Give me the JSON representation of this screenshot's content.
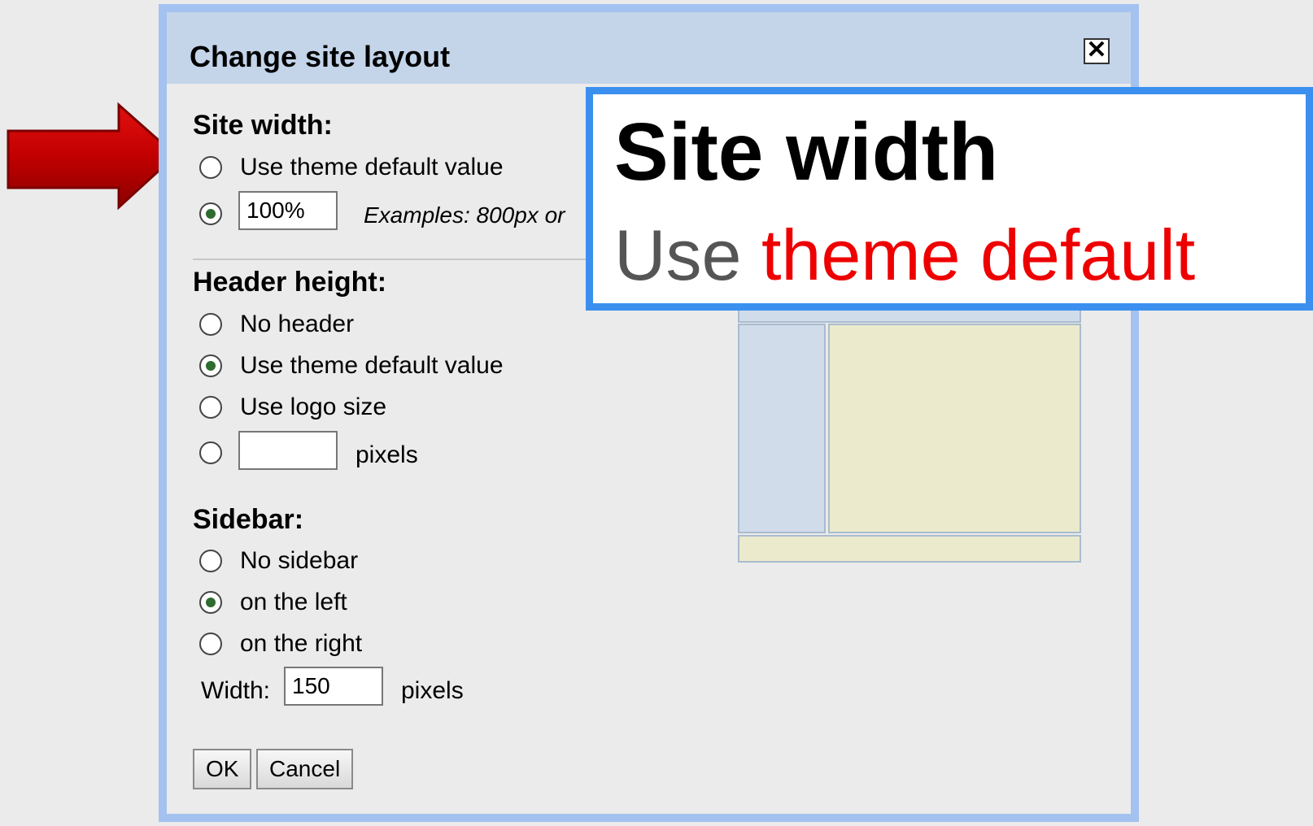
{
  "dialog": {
    "title": "Change site layout",
    "close_symbol": "✕",
    "site_width": {
      "heading": "Site width:",
      "option_default": "Use theme default value",
      "value": "100%",
      "examples": "Examples: 800px or"
    },
    "header_height": {
      "heading": "Header height:",
      "options": [
        "No header",
        "Use theme default value",
        "Use logo size"
      ],
      "custom_value": "",
      "custom_unit": "pixels"
    },
    "sidebar": {
      "heading": "Sidebar:",
      "options": [
        "No sidebar",
        "on the left",
        "on the right"
      ],
      "width_label": "Width:",
      "width_value": "150",
      "width_unit": "pixels"
    },
    "buttons": {
      "ok": "OK",
      "cancel": "Cancel"
    }
  },
  "callout": {
    "title": "Site width",
    "subtitle_plain": "Use",
    "subtitle_highlight": "theme default",
    "highlight_color": "#ee0000",
    "border_color": "#3b90ef"
  },
  "colors": {
    "arrow": "#c40000",
    "dialog_border": "#a4c2ef",
    "titlebar": "#c4d5ea",
    "preview_sidebar": "#d0dcea",
    "preview_content": "#ebeacd"
  },
  "icons": {
    "arrow": "red-arrow-icon",
    "close": "close-icon"
  }
}
